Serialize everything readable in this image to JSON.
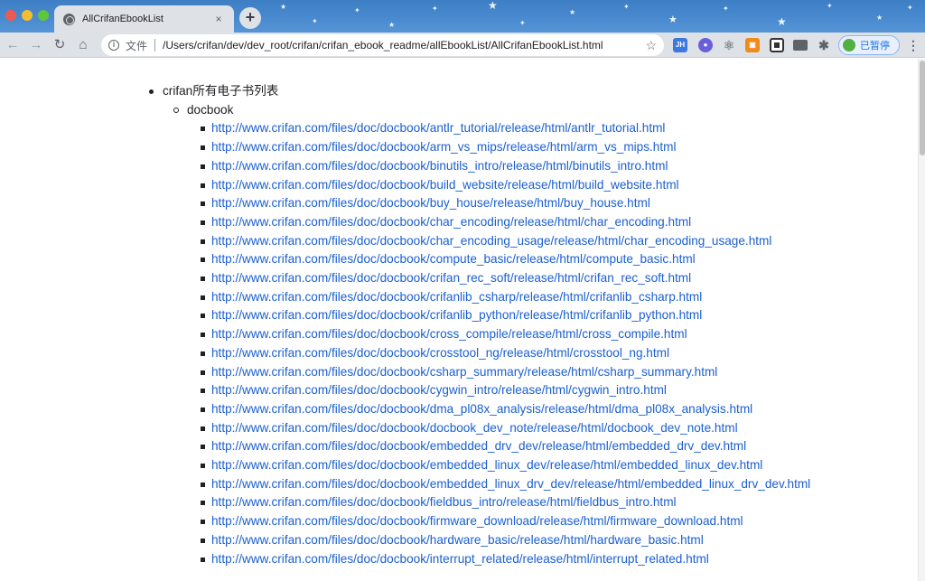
{
  "browser": {
    "tab_title": "AllCrifanEbookList",
    "tab_close_glyph": "×",
    "new_tab_glyph": "+",
    "address_scheme_label": "文件",
    "address_url": "/Users/crifan/dev/dev_root/crifan/crifan_ebook_readme/allEbookList/AllCrifanEbookList.html",
    "profile_label": "已暂停",
    "extensions": [
      "jh-ext-icon",
      "circle-ext-icon",
      "react-devtools-icon",
      "orange-ext-icon",
      "qr-code-icon",
      "side-panel-icon",
      "puzzle-extensions-icon"
    ],
    "colors": {
      "titlebar": "#4a8bd0",
      "toolbar": "#dee1e6",
      "link": "#1a5fd0"
    }
  },
  "page": {
    "root_item": "crifan所有电子书列表",
    "section_title": "docbook",
    "links": [
      "http://www.crifan.com/files/doc/docbook/antlr_tutorial/release/html/antlr_tutorial.html",
      "http://www.crifan.com/files/doc/docbook/arm_vs_mips/release/html/arm_vs_mips.html",
      "http://www.crifan.com/files/doc/docbook/binutils_intro/release/html/binutils_intro.html",
      "http://www.crifan.com/files/doc/docbook/build_website/release/html/build_website.html",
      "http://www.crifan.com/files/doc/docbook/buy_house/release/html/buy_house.html",
      "http://www.crifan.com/files/doc/docbook/char_encoding/release/html/char_encoding.html",
      "http://www.crifan.com/files/doc/docbook/char_encoding_usage/release/html/char_encoding_usage.html",
      "http://www.crifan.com/files/doc/docbook/compute_basic/release/html/compute_basic.html",
      "http://www.crifan.com/files/doc/docbook/crifan_rec_soft/release/html/crifan_rec_soft.html",
      "http://www.crifan.com/files/doc/docbook/crifanlib_csharp/release/html/crifanlib_csharp.html",
      "http://www.crifan.com/files/doc/docbook/crifanlib_python/release/html/crifanlib_python.html",
      "http://www.crifan.com/files/doc/docbook/cross_compile/release/html/cross_compile.html",
      "http://www.crifan.com/files/doc/docbook/crosstool_ng/release/html/crosstool_ng.html",
      "http://www.crifan.com/files/doc/docbook/csharp_summary/release/html/csharp_summary.html",
      "http://www.crifan.com/files/doc/docbook/cygwin_intro/release/html/cygwin_intro.html",
      "http://www.crifan.com/files/doc/docbook/dma_pl08x_analysis/release/html/dma_pl08x_analysis.html",
      "http://www.crifan.com/files/doc/docbook/docbook_dev_note/release/html/docbook_dev_note.html",
      "http://www.crifan.com/files/doc/docbook/embedded_drv_dev/release/html/embedded_drv_dev.html",
      "http://www.crifan.com/files/doc/docbook/embedded_linux_dev/release/html/embedded_linux_dev.html",
      "http://www.crifan.com/files/doc/docbook/embedded_linux_drv_dev/release/html/embedded_linux_drv_dev.html",
      "http://www.crifan.com/files/doc/docbook/fieldbus_intro/release/html/fieldbus_intro.html",
      "http://www.crifan.com/files/doc/docbook/firmware_download/release/html/firmware_download.html",
      "http://www.crifan.com/files/doc/docbook/hardware_basic/release/html/hardware_basic.html",
      "http://www.crifan.com/files/doc/docbook/interrupt_related/release/html/interrupt_related.html"
    ]
  }
}
